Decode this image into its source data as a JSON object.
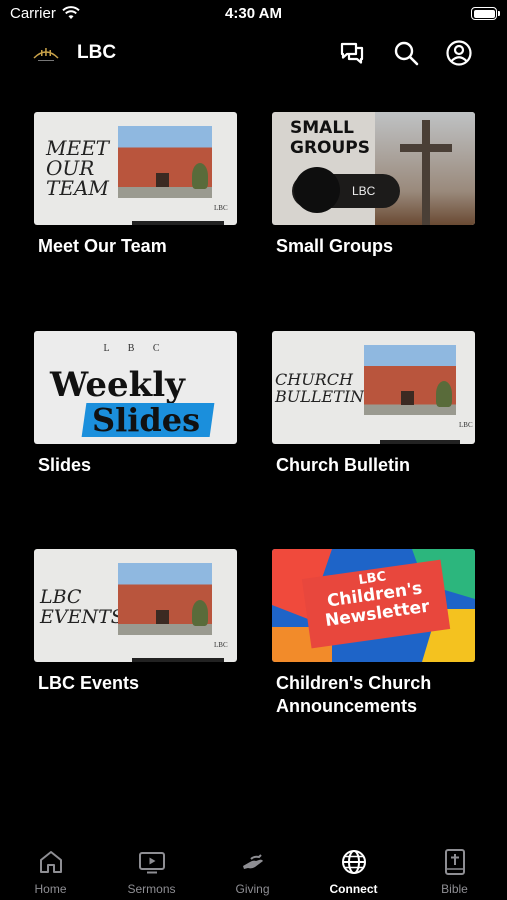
{
  "status_bar": {
    "carrier": "Carrier",
    "time": "4:30 AM"
  },
  "header": {
    "title": "LBC",
    "icons": [
      "chat-icon",
      "search-icon",
      "profile-icon"
    ]
  },
  "tiles": [
    {
      "label": "Meet Our Team",
      "thumb_text": "MEET OUR TEAM"
    },
    {
      "label": "Small Groups",
      "thumb_text": "SMALL GROUPS",
      "thumb_pill": "LBC"
    },
    {
      "label": "Slides",
      "thumb_top": "L B C",
      "thumb_line1": "Weekly",
      "thumb_line2": "Slides"
    },
    {
      "label": "Church Bulletin",
      "thumb_text": "CHURCH BULLETIN"
    },
    {
      "label": "LBC Events",
      "thumb_text": "LBC EVENTS"
    },
    {
      "label": "Children's Church Announcements",
      "thumb_line1": "LBC",
      "thumb_line2": "Children's",
      "thumb_line3": "Newsletter"
    }
  ],
  "thumb_mark": "LBC",
  "tabs": [
    {
      "label": "Home",
      "icon": "home-icon"
    },
    {
      "label": "Sermons",
      "icon": "tv-icon"
    },
    {
      "label": "Giving",
      "icon": "giving-hand-icon"
    },
    {
      "label": "Connect",
      "icon": "globe-icon",
      "active": true
    },
    {
      "label": "Bible",
      "icon": "bible-icon"
    }
  ],
  "colors": {
    "background": "#000000",
    "active_tab": "#ffffff",
    "inactive_tab": "#8e8e93",
    "brush_blue": "#1b8fdc"
  }
}
